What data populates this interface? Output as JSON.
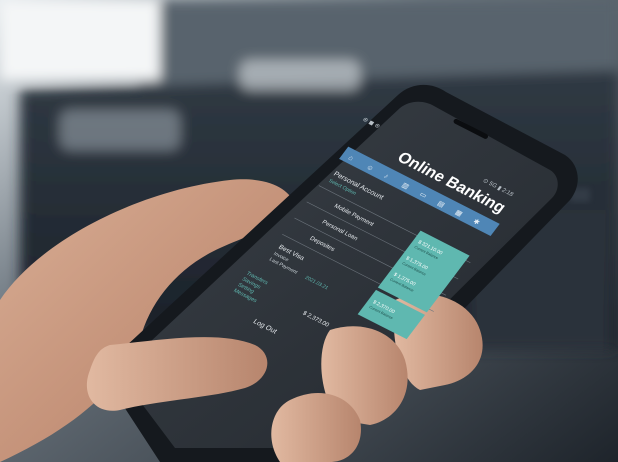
{
  "photo": {
    "status_bar": {
      "left": "⊕ ◼ ⊛",
      "right": "⊙ 5G ▮ 2:18"
    },
    "app": {
      "title": "Online Banking",
      "accent_color": "#5fb8b0",
      "nav_bar_color": "#4f86b6",
      "nav_icons": [
        "home-icon",
        "user-icon",
        "bell-icon",
        "building-icon",
        "card-icon",
        "document-icon",
        "chart-icon",
        "mail-icon",
        "settings-icon"
      ],
      "account": {
        "title": "Personal Account",
        "subtitle": "Select Option"
      },
      "menu_items": [
        {
          "label": "Mobile Payment",
          "amount": "$ 321.10.00",
          "caption": "Current Balance"
        },
        {
          "label": "Personal Loan",
          "amount": "$ 1,375.00",
          "caption": "Current Balance"
        },
        {
          "label": "Deposites",
          "amount": "$ 1,375.00",
          "caption": "Current Balance"
        }
      ],
      "card": {
        "name": "Best Visa",
        "line1": "Invoice",
        "line2": "Last Payment",
        "date": "2021.03.21",
        "amount": "$ 2,370.00",
        "caption": "Current Balance"
      },
      "bullets": [
        "Transfers",
        "Savings",
        "Setting",
        "Messages"
      ],
      "balance": "$ 2,373.00",
      "logout": "Log Out"
    },
    "colors": {
      "phone_body": "#1b1f24",
      "screen": "#2b3036",
      "skin": "#c99a82",
      "background_dark": "#2a3038"
    }
  }
}
